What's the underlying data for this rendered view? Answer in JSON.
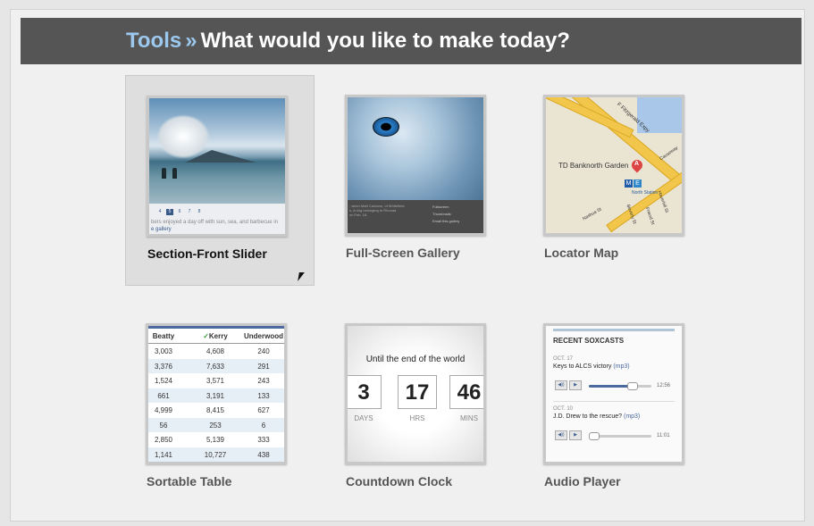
{
  "header": {
    "section": "Tools",
    "separator": "»",
    "question": "What would you like to make today?"
  },
  "tools": [
    {
      "label": "Section-Front Slider",
      "selected": true
    },
    {
      "label": "Full-Screen Gallery",
      "selected": false
    },
    {
      "label": "Locator Map",
      "selected": false
    },
    {
      "label": "Sortable Table",
      "selected": false
    },
    {
      "label": "Countdown Clock",
      "selected": false
    },
    {
      "label": "Audio Player",
      "selected": false
    }
  ],
  "slider_preview": {
    "pages": [
      "4",
      "5",
      "6",
      "7",
      "8"
    ],
    "current_page": "5",
    "caption": "bers enjoyed a day off with sun, sea, and barbecue in",
    "link": "e gallery"
  },
  "gallery_preview": {
    "caption_lines": [
      ", when Matt Cardone, of Whitefield,",
      "s. A dog belonging to Rhonda",
      "on Feb. 18."
    ],
    "menu": [
      "Fullscreen",
      "Thumbnails",
      "Email this gallery"
    ]
  },
  "map_preview": {
    "labels": [
      "TD Banknorth Garden",
      "F Fitzgerald Expy",
      "North Station",
      "Causeway",
      "Nashua St",
      "Beverly St",
      "Friend St",
      "Haverhill St",
      "Valenti Way",
      "Lomasney Way",
      "A",
      "M",
      "E"
    ]
  },
  "table_preview": {
    "columns": [
      "Beatty",
      "Kerry",
      "Underwood"
    ],
    "checked_column": "Kerry",
    "check_mark": "✓",
    "rows": [
      [
        "3,003",
        "4,608",
        "240"
      ],
      [
        "3,376",
        "7,633",
        "291"
      ],
      [
        "1,524",
        "3,571",
        "243"
      ],
      [
        "661",
        "3,191",
        "133"
      ],
      [
        "4,999",
        "8,415",
        "627"
      ],
      [
        "56",
        "253",
        "6"
      ],
      [
        "2,850",
        "5,139",
        "333"
      ],
      [
        "1,141",
        "10,727",
        "438"
      ]
    ]
  },
  "clock_preview": {
    "title": "Until the end of the world",
    "units": [
      {
        "value": "3",
        "label": "DAYS"
      },
      {
        "value": "17",
        "label": "HRS"
      },
      {
        "value": "46",
        "label": "MINS"
      }
    ]
  },
  "audio_preview": {
    "heading": "RECENT SOXCASTS",
    "tracks": [
      {
        "date": "OCT. 17",
        "title": "Keys to ALCS victory",
        "format": "(mp3)",
        "time": "12:56",
        "progress": 0.7
      },
      {
        "date": "OCT. 10",
        "title": "J.D. Drew to the rescue?",
        "format": "(mp3)",
        "time": "11:01",
        "progress": 0.0
      }
    ],
    "buttons": [
      "◀))",
      "▶"
    ]
  },
  "icons": [
    "volume-icon",
    "play-icon",
    "map-pin-icon",
    "mouse-cursor-icon"
  ]
}
